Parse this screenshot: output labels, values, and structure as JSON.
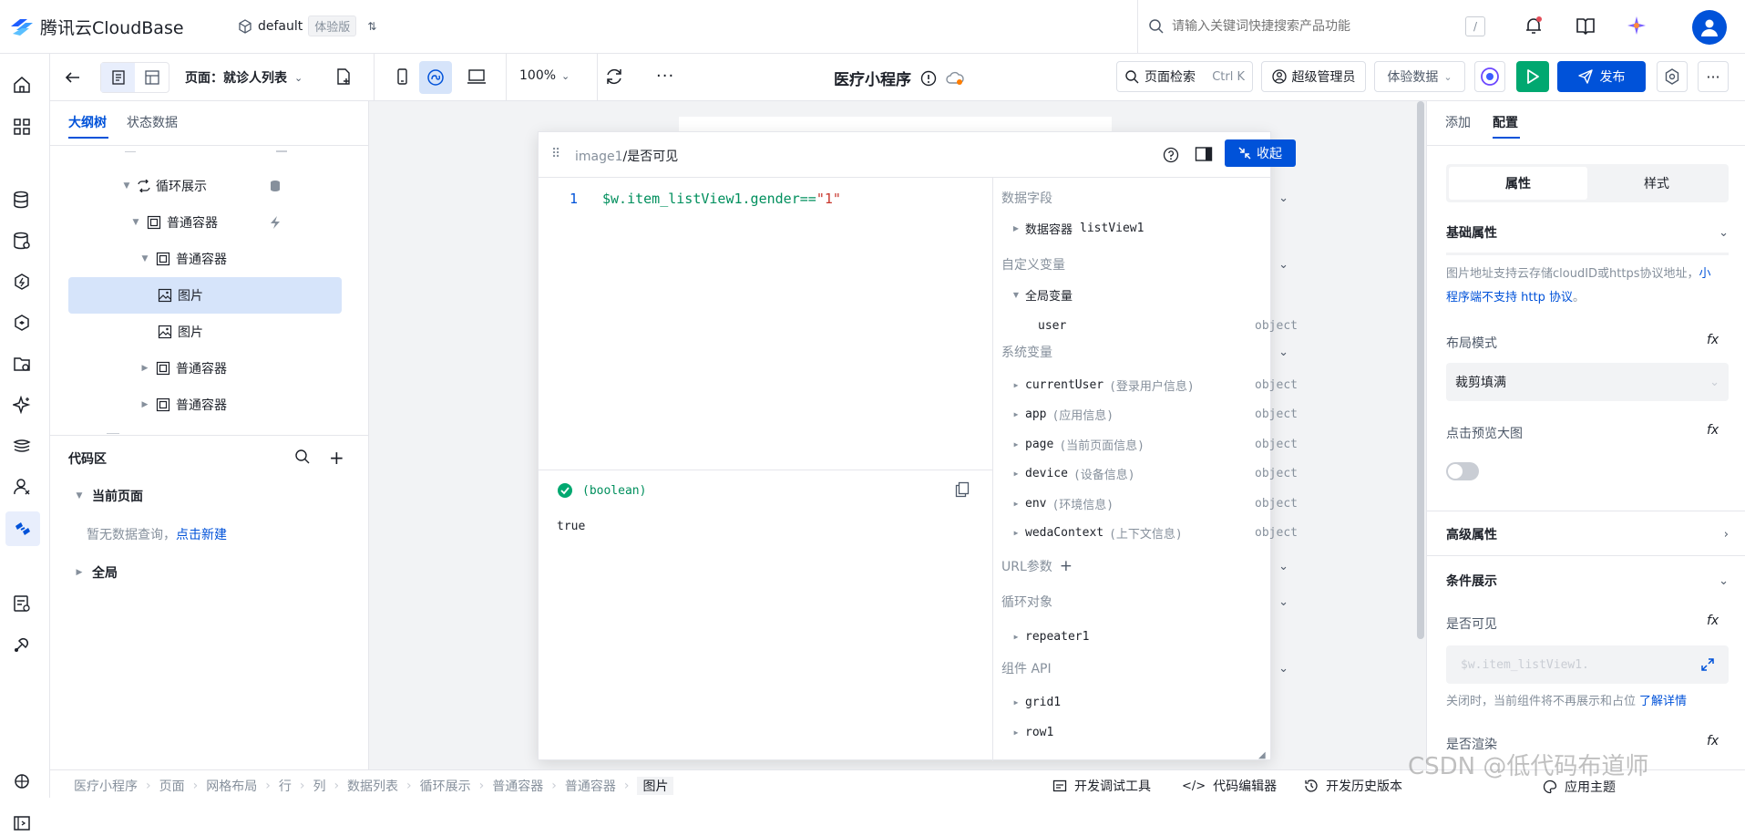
{
  "topbar": {
    "brand": "腾讯云CloudBase",
    "env_name": "default",
    "env_badge": "体验版",
    "search_placeholder": "请输入关键词快捷搜索产品功能",
    "search_shortcut": "/"
  },
  "toolbar": {
    "page_label": "页面：就诊人列表",
    "zoom": "100%",
    "app_title": "医疗小程序",
    "page_search": "页面检索",
    "page_search_shortcut": "Ctrl K",
    "role": "超级管理员",
    "data_mode": "体验数据",
    "publish": "发布"
  },
  "outline": {
    "tabs": [
      "大纲树",
      "状态数据"
    ],
    "tree": [
      {
        "label": "循环展示",
        "icon": "loop-icon"
      },
      {
        "label": "普通容器",
        "icon": "container-icon"
      },
      {
        "label": "普通容器",
        "icon": "container-icon"
      },
      {
        "label": "图片",
        "icon": "image-icon"
      },
      {
        "label": "图片",
        "icon": "image-icon"
      },
      {
        "label": "普通容器",
        "icon": "container-icon"
      },
      {
        "label": "普通容器",
        "icon": "container-icon"
      }
    ],
    "code_area": {
      "title": "代码区",
      "current_page": "当前页面",
      "empty_text": "暂无数据查询，",
      "create_link": "点击新建",
      "global": "全局"
    }
  },
  "editor": {
    "breadcrumb_prefix": "image1",
    "breadcrumb_current": "/是否可见",
    "collapse": "收起",
    "line_number": "1",
    "code_prefix": "$w.item_listView1.gender==",
    "code_string": "\"1\"",
    "result_type": "(boolean)",
    "result_value": "true",
    "vars": {
      "data_fields": "数据字段",
      "data_container": "数据容器",
      "data_container_name": "listView1",
      "custom_vars": "自定义变量",
      "global_vars": "全局变量",
      "user": "user",
      "system_vars": "系统变量",
      "system_items": [
        {
          "name": "currentUser",
          "desc": "(登录用户信息)",
          "type": "object"
        },
        {
          "name": "app",
          "desc": "(应用信息)",
          "type": "object"
        },
        {
          "name": "page",
          "desc": "(当前页面信息)",
          "type": "object"
        },
        {
          "name": "device",
          "desc": "(设备信息)",
          "type": "object"
        },
        {
          "name": "env",
          "desc": "(环境信息)",
          "type": "object"
        },
        {
          "name": "wedaContext",
          "desc": "(上下文信息)",
          "type": "object"
        }
      ],
      "object_type": "object",
      "url_params": "URL参数",
      "loop_objects": "循环对象",
      "repeater": "repeater1",
      "component_api": "组件 API",
      "grid": "grid1",
      "row": "row1"
    }
  },
  "right": {
    "tabs": [
      "添加",
      "配置"
    ],
    "subtabs": [
      "属性",
      "样式"
    ],
    "basic": "基础属性",
    "hint_1": "图片地址支持云存储cloudID或https协议地址，",
    "hint_link": "小程序端不支持 http 协议",
    "hint_end": "。",
    "layout_mode": "布局模式",
    "layout_value": "裁剪填满",
    "preview": "点击预览大图",
    "advanced": "高级属性",
    "condition": "条件展示",
    "visible": "是否可见",
    "visible_value": "$w.item_listView1.",
    "visible_hint": "关闭时，当前组件将不再展示和占位",
    "learn_more": "了解详情",
    "render": "是否渲染",
    "fx": "fx"
  },
  "bottom": {
    "crumbs": [
      "医疗小程序",
      "页面",
      "网格布局",
      "行",
      "列",
      "数据列表",
      "循环展示",
      "普通容器",
      "普通容器",
      "图片"
    ],
    "dev_tools": "开发调试工具",
    "code_editor": "代码编辑器",
    "history": "开发历史版本",
    "theme": "应用主题",
    "watermark": "CSDN @低代码布道师"
  },
  "colors": {
    "accent": "#0052d9",
    "green": "#00a870",
    "selected": "#d6e4fa"
  }
}
